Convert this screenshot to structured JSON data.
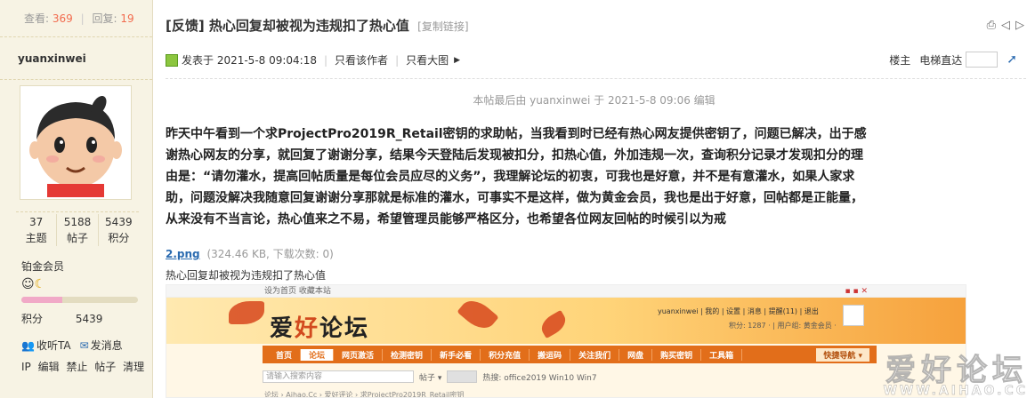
{
  "sidebar": {
    "views_label": "查看:",
    "views": "369",
    "replies_label": "回复:",
    "replies": "19",
    "username": "yuanxinwei",
    "counts": [
      {
        "value": "37",
        "label": "主题"
      },
      {
        "value": "5188",
        "label": "帖子"
      },
      {
        "value": "5439",
        "label": "积分"
      }
    ],
    "group": "铂金会员",
    "progress_fraction": 0.35,
    "credit_label": "积分",
    "credit_value": "5439",
    "follow": "收听TA",
    "message": "发消息",
    "admin_links": [
      "IP",
      "编辑",
      "禁止",
      "帖子",
      "清理"
    ]
  },
  "post": {
    "title": "[反馈] 热心回复却被视为违规扣了热心值",
    "copy_link": "[复制链接]",
    "posted_at": "发表于 2021-5-8 09:04:18",
    "only_author": "只看该作者",
    "big_image": "只看大图",
    "floor": "楼主",
    "jump_label": "电梯直达",
    "edited": "本帖最后由 yuanxinwei 于 2021-5-8 09:06 编辑",
    "body": "昨天中午看到一个求ProjectPro2019R_Retail密钥的求助帖，当我看到时已经有热心网友提供密钥了，问题已解决，出于感谢热心网友的分享，就回复了谢谢分享，结果今天登陆后发现被扣分，扣热心值，外加违规一次，查询积分记录才发现扣分的理由是：“请勿灌水，提高回帖质量是每位会员应尽的义务”，我理解论坛的初衷，可我也是好意，并不是有意灌水，如果人家求助，问题没解决我随意回复谢谢分享那就是标准的灌水，可事实不是这样，做为黄金会员，我也是出于好意，回帖都是正能量，从来没有不当言论，热心值来之不易，希望管理员能够严格区分，也希望各位网友回帖的时候引以为戒",
    "attachment_name": "2.png",
    "attachment_meta": "(324.46 KB, 下载次数: 0)",
    "caption": "热心回复却被视为违规扣了热心值"
  },
  "screenshot": {
    "strip_text": "设为首页  收藏本站",
    "logo": [
      "爱",
      "好",
      "论坛"
    ],
    "user_line": "yuanxinwei | 我的 | 设置 | 消息 | 提醒(11) | 退出",
    "user_line2": "积分: 1287 · | 用户组: 黄金会员 ·",
    "nav": [
      "首页",
      "论坛",
      "网页激活",
      "检测密钥",
      "新手必看",
      "积分充值",
      "搬运码",
      "关注我们",
      "网盘",
      "购买密钥",
      "工具箱"
    ],
    "quick": "快捷导航 ▾",
    "search_placeholder": "请输入搜索内容",
    "search_scope": "帖子 ▾",
    "hot": "热搜: office2019 Win10 Win7",
    "crumb": "论坛 › Aihao.Cc › 爱好评论 › 求ProjectPro2019R_Retail密钥"
  },
  "watermark": {
    "cn": "爱好论坛",
    "en": "WWW.AIHAO.CC"
  }
}
